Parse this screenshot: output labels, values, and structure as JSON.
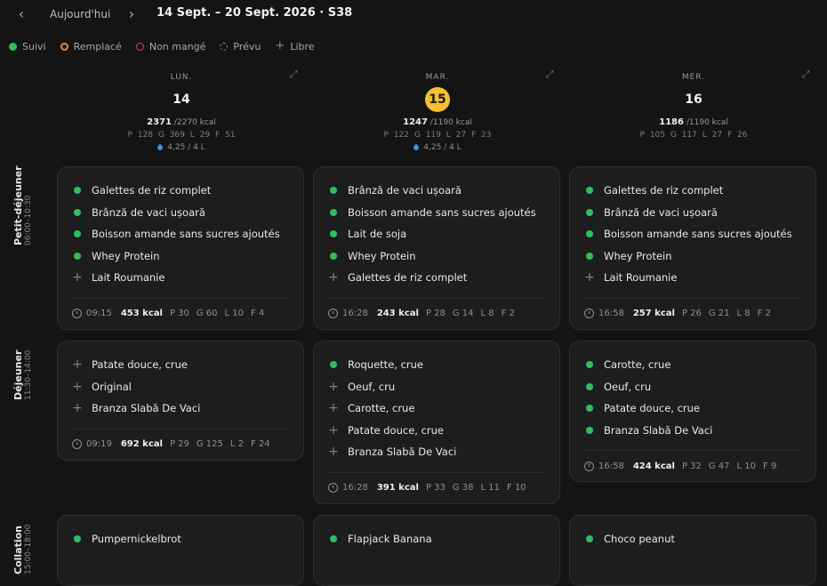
{
  "header": {
    "prev_icon": "chevron-left-icon",
    "today_label": "Aujourd'hui",
    "next_icon": "chevron-right-icon",
    "range": "14 Sept. – 20 Sept. 2026 · S38"
  },
  "legend": [
    {
      "label": "Suivi",
      "icon": "filled-green-dot"
    },
    {
      "label": "Remplacé",
      "icon": "orange-ring-dot"
    },
    {
      "label": "Non mangé",
      "icon": "red-circle"
    },
    {
      "label": "Prévu",
      "icon": "dashed-circle"
    },
    {
      "label": "Libre",
      "icon": "plus-icon"
    }
  ],
  "colors": {
    "suivi": "#2fbf5b",
    "remplace": "#e8893a",
    "non_mange": "#e04444",
    "today": "#f4c02c",
    "water": "#3a93e0"
  },
  "days": [
    {
      "name": "LUN.",
      "num": "14",
      "kcal": "2371",
      "kcal_goal": "/2270 kcal",
      "p": "P 128",
      "g": "G 369",
      "l": "L 29",
      "f": "F 51",
      "water": "4,25 / 4 L"
    },
    {
      "name": "MAR.",
      "num": "15",
      "kcal": "1247",
      "kcal_goal": "/1190 kcal",
      "p": "P 122",
      "g": "G 119",
      "l": "L 27",
      "f": "F 23",
      "water": "4,25 / 4 L"
    },
    {
      "name": "MER.",
      "num": "16",
      "kcal": "1186",
      "kcal_goal": "/1190 kcal",
      "p": "P 105",
      "g": "G 117",
      "l": "L 27",
      "f": "F 26"
    }
  ],
  "meals": [
    {
      "name": "Petit-déjeuner",
      "time": "06:00–10:30"
    },
    {
      "name": "Déjeuner",
      "time": "11:30–14:00"
    },
    {
      "name": "Collation",
      "time": "15:00–18:00"
    }
  ],
  "cards": {
    "bf_mon": {
      "items": [
        {
          "status": "suivi",
          "name": "Galettes de riz complet"
        },
        {
          "status": "suivi",
          "name": "Brânză de vaci ușoară"
        },
        {
          "status": "suivi",
          "name": "Boisson amande sans sucres ajoutés"
        },
        {
          "status": "suivi",
          "name": "Whey Protein"
        },
        {
          "status": "libre",
          "name": "Lait Roumanie"
        }
      ],
      "time": "09:15",
      "kcal": "453 kcal",
      "p": "P 30",
      "g": "G 60",
      "l": "L 10",
      "f": "F 4"
    },
    "bf_tue": {
      "items": [
        {
          "status": "suivi",
          "name": "Brânză de vaci ușoară"
        },
        {
          "status": "suivi",
          "name": "Boisson amande sans sucres ajoutés"
        },
        {
          "status": "suivi",
          "name": "Lait de soja"
        },
        {
          "status": "suivi",
          "name": "Whey Protein"
        },
        {
          "status": "libre",
          "name": "Galettes de riz complet"
        }
      ],
      "time": "16:28",
      "kcal": "243 kcal",
      "p": "P 28",
      "g": "G 14",
      "l": "L 8",
      "f": "F 2"
    },
    "bf_wed": {
      "items": [
        {
          "status": "suivi",
          "name": "Galettes de riz complet"
        },
        {
          "status": "suivi",
          "name": "Brânză de vaci ușoară"
        },
        {
          "status": "suivi",
          "name": "Boisson amande sans sucres ajoutés"
        },
        {
          "status": "suivi",
          "name": "Whey Protein"
        },
        {
          "status": "libre",
          "name": "Lait Roumanie"
        }
      ],
      "time": "16:58",
      "kcal": "257 kcal",
      "p": "P 26",
      "g": "G 21",
      "l": "L 8",
      "f": "F 2"
    },
    "lu_mon": {
      "items": [
        {
          "status": "libre",
          "name": "Patate douce, crue"
        },
        {
          "status": "libre",
          "name": "Original"
        },
        {
          "status": "libre",
          "name": "Branza Slabă De Vaci"
        }
      ],
      "time": "09:19",
      "kcal": "692 kcal",
      "p": "P 29",
      "g": "G 125",
      "l": "L 2",
      "f": "F 24"
    },
    "lu_tue": {
      "items": [
        {
          "status": "suivi",
          "name": "Roquette, crue"
        },
        {
          "status": "libre",
          "name": "Oeuf, cru"
        },
        {
          "status": "libre",
          "name": "Carotte, crue"
        },
        {
          "status": "libre",
          "name": "Patate douce, crue"
        },
        {
          "status": "libre",
          "name": "Branza Slabă De Vaci"
        }
      ],
      "time": "16:28",
      "kcal": "391 kcal",
      "p": "P 33",
      "g": "G 38",
      "l": "L 11",
      "f": "F 10"
    },
    "lu_wed": {
      "items": [
        {
          "status": "suivi",
          "name": "Carotte, crue"
        },
        {
          "status": "suivi",
          "name": "Oeuf, cru"
        },
        {
          "status": "suivi",
          "name": "Patate douce, crue"
        },
        {
          "status": "suivi",
          "name": "Branza Slabă De Vaci"
        }
      ],
      "time": "16:58",
      "kcal": "424 kcal",
      "p": "P 32",
      "g": "G 47",
      "l": "L 10",
      "f": "F 9"
    },
    "sn_mon": {
      "items": [
        {
          "status": "suivi",
          "name": "Pumpernickelbrot"
        }
      ]
    },
    "sn_tue": {
      "items": [
        {
          "status": "suivi",
          "name": "Flapjack Banana"
        }
      ]
    },
    "sn_wed": {
      "items": [
        {
          "status": "suivi",
          "name": "Choco peanut"
        }
      ]
    }
  }
}
